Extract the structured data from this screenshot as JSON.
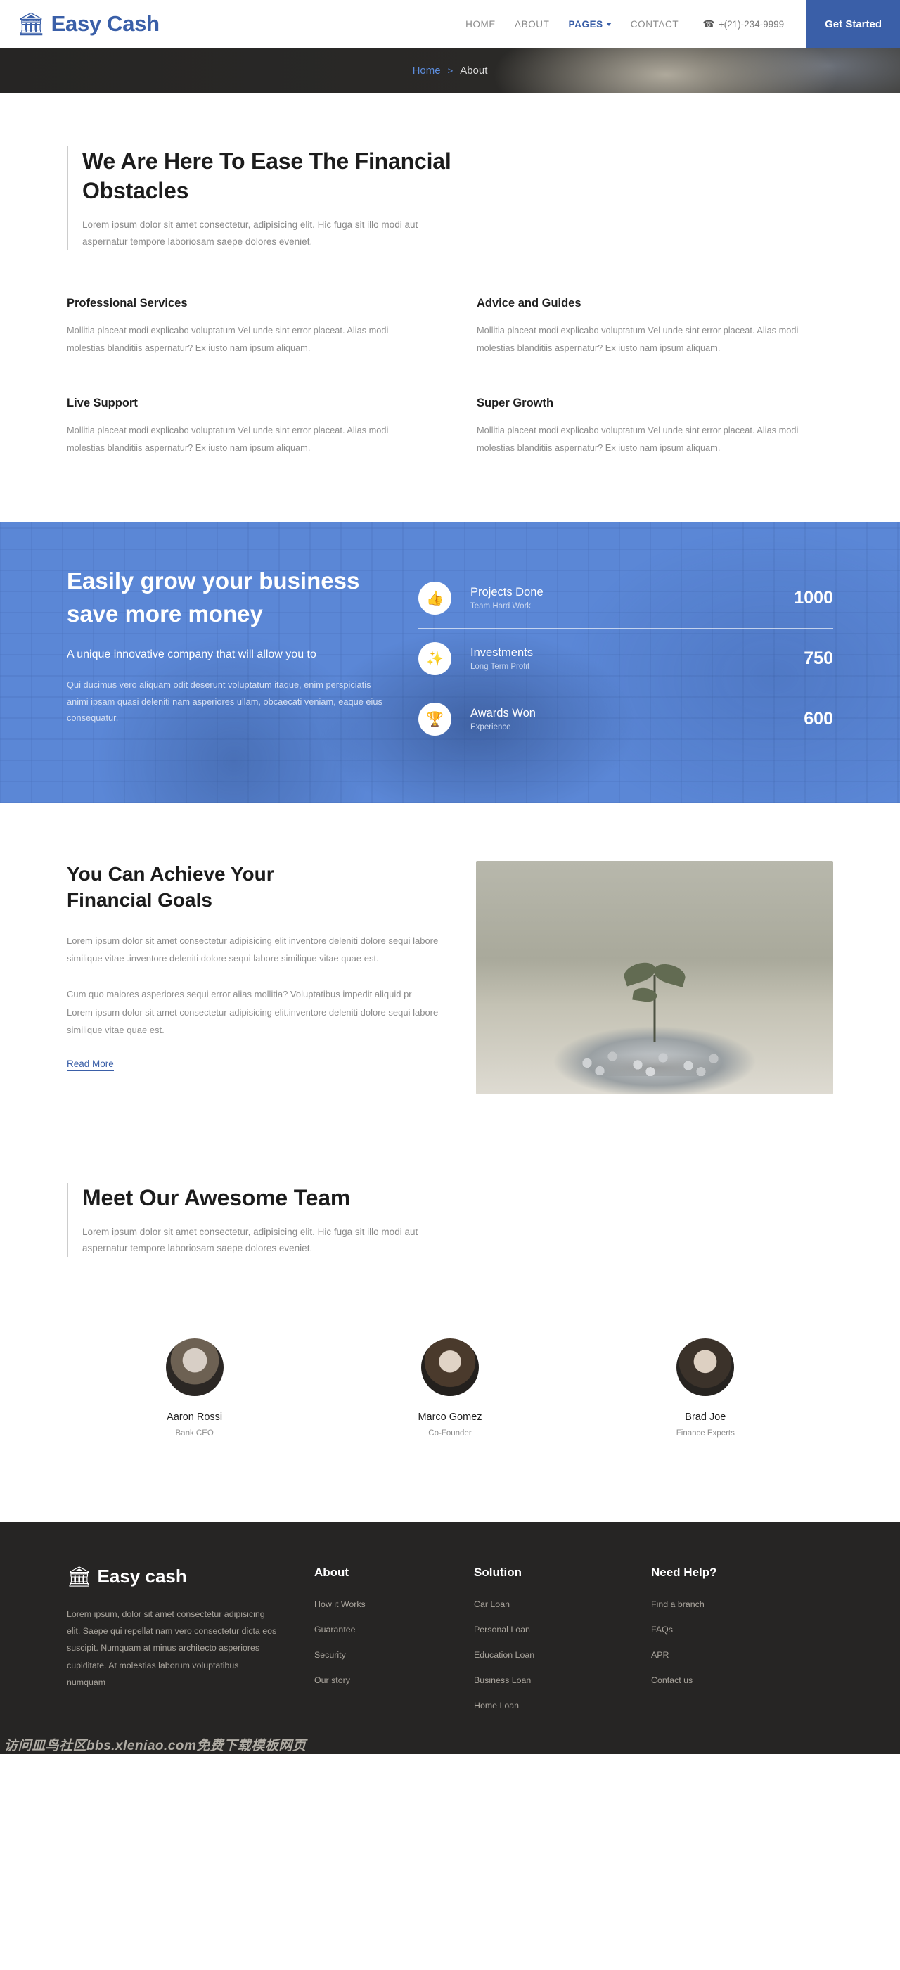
{
  "nav": {
    "brand": "Easy Cash",
    "brand_icon": "bank-icon",
    "links": [
      {
        "label": "HOME",
        "active": false
      },
      {
        "label": "ABOUT",
        "active": false
      },
      {
        "label": "PAGES",
        "active": true,
        "has_caret": true
      },
      {
        "label": "CONTACT",
        "active": false
      }
    ],
    "phone": "+(21)-234-9999",
    "phone_icon": "phone-icon",
    "cta": "Get Started",
    "accent": "#3a5fa8"
  },
  "breadcrumb": {
    "home": "Home",
    "separator": ">",
    "current": "About"
  },
  "intro": {
    "heading": "We Are Here To Ease The Financial Obstacles",
    "lead": "Lorem ipsum dolor sit amet consectetur, adipisicing elit. Hic fuga sit illo modi aut aspernatur tempore laboriosam saepe dolores eveniet."
  },
  "features": [
    {
      "title": "Professional Services",
      "body": "Mollitia placeat modi explicabo voluptatum Vel unde sint error placeat. Alias modi molestias blanditiis aspernatur? Ex iusto nam ipsum aliquam."
    },
    {
      "title": "Advice and Guides",
      "body": "Mollitia placeat modi explicabo voluptatum Vel unde sint error placeat. Alias modi molestias blanditiis aspernatur? Ex iusto nam ipsum aliquam."
    },
    {
      "title": "Live Support",
      "body": "Mollitia placeat modi explicabo voluptatum Vel unde sint error placeat. Alias modi molestias blanditiis aspernatur? Ex iusto nam ipsum aliquam."
    },
    {
      "title": "Super Growth",
      "body": "Mollitia placeat modi explicabo voluptatum Vel unde sint error placeat. Alias modi molestias blanditiis aspernatur? Ex iusto nam ipsum aliquam."
    }
  ],
  "growth": {
    "heading": "Easily grow your business save more money",
    "subheading": "A unique innovative company that will allow you to",
    "paragraph": "Qui ducimus vero aliquam odit deserunt voluptatum itaque, enim perspiciatis animi ipsam quasi deleniti nam asperiores ullam, obcaecati veniam, eaque eius consequatur.",
    "bg_color": "#5b87d6",
    "stats": [
      {
        "icon": "thumbs-up-icon",
        "label": "Projects Done",
        "note": "Team Hard Work",
        "value": "1000"
      },
      {
        "icon": "magic-wand-icon",
        "label": "Investments",
        "note": "Long Term Profit",
        "value": "750"
      },
      {
        "icon": "trophy-icon",
        "label": "Awards Won",
        "note": "Experience",
        "value": "600"
      }
    ]
  },
  "goals": {
    "heading": "You Can Achieve Your Financial Goals",
    "paragraph1": "Lorem ipsum dolor sit amet consectetur adipisicing elit inventore deleniti dolore sequi labore similique vitae .inventore deleniti dolore sequi labore similique vitae quae est.",
    "paragraph2": "Cum quo maiores asperiores sequi error alias mollitia? Voluptatibus impedit aliquid pr Lorem ipsum dolor sit amet consectetur adipisicing elit.inventore deleniti dolore sequi labore similique vitae quae est.",
    "read_more": "Read More",
    "image_alt": "plant-growing-from-coins-photo"
  },
  "team": {
    "heading": "Meet Our Awesome Team",
    "lead": "Lorem ipsum dolor sit amet consectetur, adipisicing elit. Hic fuga sit illo modi aut aspernatur tempore laboriosam saepe dolores eveniet.",
    "members": [
      {
        "name": "Aaron Rossi",
        "role": "Bank CEO"
      },
      {
        "name": "Marco Gomez",
        "role": "Co-Founder"
      },
      {
        "name": "Brad Joe",
        "role": "Finance Experts"
      }
    ]
  },
  "footer": {
    "brand": "Easy cash",
    "brand_icon": "bank-icon",
    "description": "Lorem ipsum, dolor sit amet consectetur adipisicing elit. Saepe qui repellat nam vero consectetur dicta eos suscipit. Numquam at minus architecto asperiores cupiditate. At molestias laborum voluptatibus numquam",
    "columns": [
      {
        "heading": "About",
        "links": [
          "How it Works",
          "Guarantee",
          "Security",
          "Our story"
        ]
      },
      {
        "heading": "Solution",
        "links": [
          "Car Loan",
          "Personal Loan",
          "Education Loan",
          "Business Loan",
          "Home Loan"
        ]
      },
      {
        "heading": "Need Help?",
        "links": [
          "Find a branch",
          "FAQs",
          "APR",
          "Contact us"
        ]
      }
    ],
    "watermark": "访问皿鸟社区bbs.xleniao.com免费下载模板网页"
  }
}
